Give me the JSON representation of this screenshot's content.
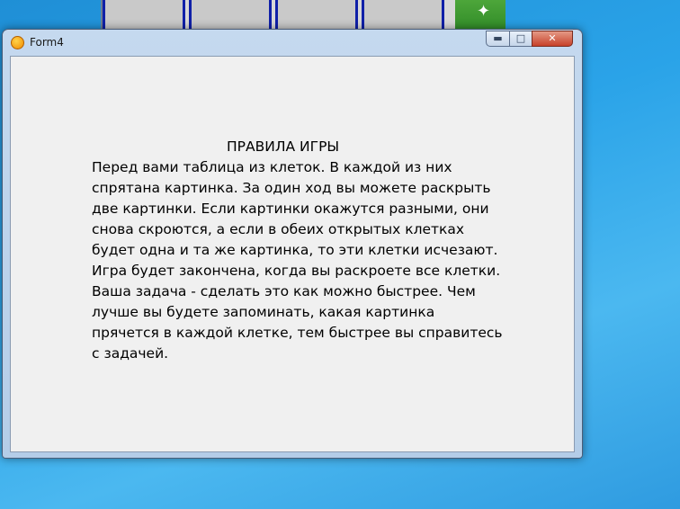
{
  "window": {
    "title": "Form4",
    "controls": {
      "minimize": "▬",
      "maximize": "□",
      "close": "✕"
    }
  },
  "rules": {
    "heading": "ПРАВИЛА ИГРЫ",
    "body": "Перед вами таблица из клеток. В каждой из них\nспрятана картинка. За один ход вы можете раскрыть\nдве картинки. Если картинки окажутся разными, они\nснова скроются, а если в обеих открытых клетках\nбудет одна и та же картинка, то эти клетки исчезают.\nИгра будет закончена, когда вы раскроете все клетки.\nВаша задача - сделать это как можно быстрее. Чем\nлучше вы будете запоминать, какая картинка\nпрячется в каждой клетке, тем быстрее вы справитесь\nс задачей."
  },
  "icons": {
    "app": "smiley-icon",
    "background_decoration": "butterfly-icon"
  },
  "colors": {
    "desktop": "#2aa3e8",
    "client_bg": "#f0f0f0",
    "grid_border": "#1020a8"
  }
}
